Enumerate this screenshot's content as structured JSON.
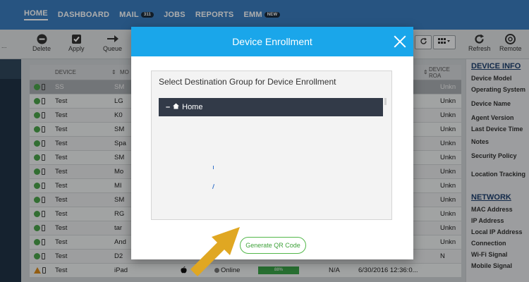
{
  "nav": {
    "items": [
      {
        "label": "HOME",
        "active": true
      },
      {
        "label": "DASHBOARD"
      },
      {
        "label": "MAIL",
        "badge": "311"
      },
      {
        "label": "JOBS"
      },
      {
        "label": "REPORTS"
      },
      {
        "label": "EMM",
        "badge": "NEW"
      }
    ]
  },
  "toolbar": {
    "left_stub": "...",
    "delete": "Delete",
    "apply": "Apply",
    "queue": "Queue",
    "refresh": "Refresh",
    "remote": "Remote"
  },
  "grid": {
    "headers": {
      "device": "DEVICE",
      "model": "MO",
      "roam": "DEVICE ROA"
    },
    "rows": [
      {
        "name": "SS",
        "model": "SM",
        "roam": "Unkn",
        "status": "ok",
        "selected": true
      },
      {
        "name": "Test",
        "model": "LG",
        "roam": "Unkn",
        "status": "ok"
      },
      {
        "name": "Test",
        "model": "K0",
        "roam": "Unkn",
        "status": "ok"
      },
      {
        "name": "Test",
        "model": "SM",
        "roam": "Unkn",
        "status": "ok"
      },
      {
        "name": "Test",
        "model": "Spa",
        "roam": "Unkn",
        "status": "ok"
      },
      {
        "name": "Test",
        "model": "SM",
        "roam": "Unkn",
        "status": "ok"
      },
      {
        "name": "Test",
        "model": "Mo",
        "roam": "Unkn",
        "status": "ok"
      },
      {
        "name": "Test",
        "model": "MI",
        "roam": "Unkn",
        "status": "ok"
      },
      {
        "name": "Test",
        "model": "SM",
        "roam": "Unkn",
        "status": "ok"
      },
      {
        "name": "Test",
        "model": "RG",
        "roam": "Unkn",
        "status": "ok"
      },
      {
        "name": "Test",
        "model": "tar",
        "roam": "Unkn",
        "status": "ok"
      },
      {
        "name": "Test",
        "model": "And",
        "roam": "Unkn",
        "status": "ok"
      },
      {
        "name": "Test",
        "model": "D2",
        "roam": "N",
        "status": "ok"
      },
      {
        "name": "Test",
        "model": "iPad",
        "os_icon": "apple-icon",
        "online": "Online",
        "battery_label": "88%",
        "na": "N/A",
        "time": "6/30/2016 12:36:0...",
        "status": "warn"
      }
    ]
  },
  "right_panel": {
    "device_info_title": "DEVICE INFO",
    "device_fields": [
      "Device Model",
      "Operating System",
      "Device Name",
      "Agent Version",
      "Last Device Time",
      "Notes",
      "Security Policy",
      "Location Tracking"
    ],
    "network_title": "NETWORK",
    "network_fields": [
      "MAC Address",
      "IP Address",
      "Local IP Address",
      "Connection",
      "Wi-Fi Signal",
      "Mobile Signal"
    ]
  },
  "modal": {
    "title": "Device Enrollment",
    "subtitle": "Select Destination Group for Device Enrollment",
    "tree_root": "Home",
    "qr_button": "Generate QR Code"
  },
  "colors": {
    "nav_bg": "#3a7dbf",
    "modal_header": "#1aa6ea",
    "tree_bg": "#323a48",
    "qr_green": "#53b84a",
    "arrow": "#e0a722"
  }
}
